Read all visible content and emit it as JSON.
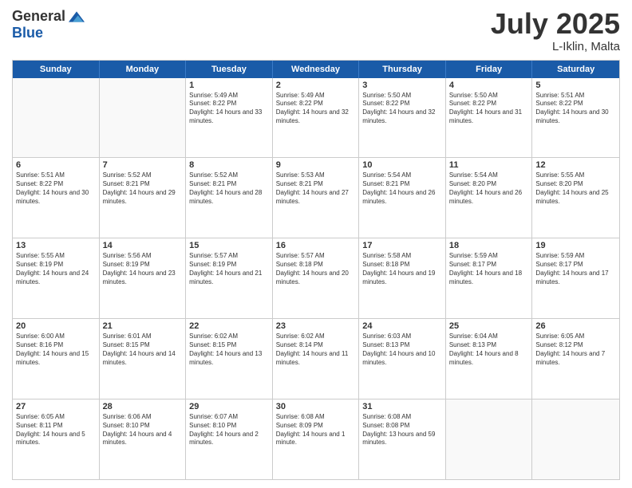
{
  "header": {
    "logo_general": "General",
    "logo_blue": "Blue",
    "month_title": "July 2025",
    "location": "L-Iklin, Malta"
  },
  "days_of_week": [
    "Sunday",
    "Monday",
    "Tuesday",
    "Wednesday",
    "Thursday",
    "Friday",
    "Saturday"
  ],
  "weeks": [
    [
      {
        "day": "",
        "empty": true
      },
      {
        "day": "",
        "empty": true
      },
      {
        "day": "1",
        "sunrise": "Sunrise: 5:49 AM",
        "sunset": "Sunset: 8:22 PM",
        "daylight": "Daylight: 14 hours and 33 minutes."
      },
      {
        "day": "2",
        "sunrise": "Sunrise: 5:49 AM",
        "sunset": "Sunset: 8:22 PM",
        "daylight": "Daylight: 14 hours and 32 minutes."
      },
      {
        "day": "3",
        "sunrise": "Sunrise: 5:50 AM",
        "sunset": "Sunset: 8:22 PM",
        "daylight": "Daylight: 14 hours and 32 minutes."
      },
      {
        "day": "4",
        "sunrise": "Sunrise: 5:50 AM",
        "sunset": "Sunset: 8:22 PM",
        "daylight": "Daylight: 14 hours and 31 minutes."
      },
      {
        "day": "5",
        "sunrise": "Sunrise: 5:51 AM",
        "sunset": "Sunset: 8:22 PM",
        "daylight": "Daylight: 14 hours and 30 minutes."
      }
    ],
    [
      {
        "day": "6",
        "sunrise": "Sunrise: 5:51 AM",
        "sunset": "Sunset: 8:22 PM",
        "daylight": "Daylight: 14 hours and 30 minutes."
      },
      {
        "day": "7",
        "sunrise": "Sunrise: 5:52 AM",
        "sunset": "Sunset: 8:21 PM",
        "daylight": "Daylight: 14 hours and 29 minutes."
      },
      {
        "day": "8",
        "sunrise": "Sunrise: 5:52 AM",
        "sunset": "Sunset: 8:21 PM",
        "daylight": "Daylight: 14 hours and 28 minutes."
      },
      {
        "day": "9",
        "sunrise": "Sunrise: 5:53 AM",
        "sunset": "Sunset: 8:21 PM",
        "daylight": "Daylight: 14 hours and 27 minutes."
      },
      {
        "day": "10",
        "sunrise": "Sunrise: 5:54 AM",
        "sunset": "Sunset: 8:21 PM",
        "daylight": "Daylight: 14 hours and 26 minutes."
      },
      {
        "day": "11",
        "sunrise": "Sunrise: 5:54 AM",
        "sunset": "Sunset: 8:20 PM",
        "daylight": "Daylight: 14 hours and 26 minutes."
      },
      {
        "day": "12",
        "sunrise": "Sunrise: 5:55 AM",
        "sunset": "Sunset: 8:20 PM",
        "daylight": "Daylight: 14 hours and 25 minutes."
      }
    ],
    [
      {
        "day": "13",
        "sunrise": "Sunrise: 5:55 AM",
        "sunset": "Sunset: 8:19 PM",
        "daylight": "Daylight: 14 hours and 24 minutes."
      },
      {
        "day": "14",
        "sunrise": "Sunrise: 5:56 AM",
        "sunset": "Sunset: 8:19 PM",
        "daylight": "Daylight: 14 hours and 23 minutes."
      },
      {
        "day": "15",
        "sunrise": "Sunrise: 5:57 AM",
        "sunset": "Sunset: 8:19 PM",
        "daylight": "Daylight: 14 hours and 21 minutes."
      },
      {
        "day": "16",
        "sunrise": "Sunrise: 5:57 AM",
        "sunset": "Sunset: 8:18 PM",
        "daylight": "Daylight: 14 hours and 20 minutes."
      },
      {
        "day": "17",
        "sunrise": "Sunrise: 5:58 AM",
        "sunset": "Sunset: 8:18 PM",
        "daylight": "Daylight: 14 hours and 19 minutes."
      },
      {
        "day": "18",
        "sunrise": "Sunrise: 5:59 AM",
        "sunset": "Sunset: 8:17 PM",
        "daylight": "Daylight: 14 hours and 18 minutes."
      },
      {
        "day": "19",
        "sunrise": "Sunrise: 5:59 AM",
        "sunset": "Sunset: 8:17 PM",
        "daylight": "Daylight: 14 hours and 17 minutes."
      }
    ],
    [
      {
        "day": "20",
        "sunrise": "Sunrise: 6:00 AM",
        "sunset": "Sunset: 8:16 PM",
        "daylight": "Daylight: 14 hours and 15 minutes."
      },
      {
        "day": "21",
        "sunrise": "Sunrise: 6:01 AM",
        "sunset": "Sunset: 8:15 PM",
        "daylight": "Daylight: 14 hours and 14 minutes."
      },
      {
        "day": "22",
        "sunrise": "Sunrise: 6:02 AM",
        "sunset": "Sunset: 8:15 PM",
        "daylight": "Daylight: 14 hours and 13 minutes."
      },
      {
        "day": "23",
        "sunrise": "Sunrise: 6:02 AM",
        "sunset": "Sunset: 8:14 PM",
        "daylight": "Daylight: 14 hours and 11 minutes."
      },
      {
        "day": "24",
        "sunrise": "Sunrise: 6:03 AM",
        "sunset": "Sunset: 8:13 PM",
        "daylight": "Daylight: 14 hours and 10 minutes."
      },
      {
        "day": "25",
        "sunrise": "Sunrise: 6:04 AM",
        "sunset": "Sunset: 8:13 PM",
        "daylight": "Daylight: 14 hours and 8 minutes."
      },
      {
        "day": "26",
        "sunrise": "Sunrise: 6:05 AM",
        "sunset": "Sunset: 8:12 PM",
        "daylight": "Daylight: 14 hours and 7 minutes."
      }
    ],
    [
      {
        "day": "27",
        "sunrise": "Sunrise: 6:05 AM",
        "sunset": "Sunset: 8:11 PM",
        "daylight": "Daylight: 14 hours and 5 minutes."
      },
      {
        "day": "28",
        "sunrise": "Sunrise: 6:06 AM",
        "sunset": "Sunset: 8:10 PM",
        "daylight": "Daylight: 14 hours and 4 minutes."
      },
      {
        "day": "29",
        "sunrise": "Sunrise: 6:07 AM",
        "sunset": "Sunset: 8:10 PM",
        "daylight": "Daylight: 14 hours and 2 minutes."
      },
      {
        "day": "30",
        "sunrise": "Sunrise: 6:08 AM",
        "sunset": "Sunset: 8:09 PM",
        "daylight": "Daylight: 14 hours and 1 minute."
      },
      {
        "day": "31",
        "sunrise": "Sunrise: 6:08 AM",
        "sunset": "Sunset: 8:08 PM",
        "daylight": "Daylight: 13 hours and 59 minutes."
      },
      {
        "day": "",
        "empty": true
      },
      {
        "day": "",
        "empty": true
      }
    ]
  ]
}
